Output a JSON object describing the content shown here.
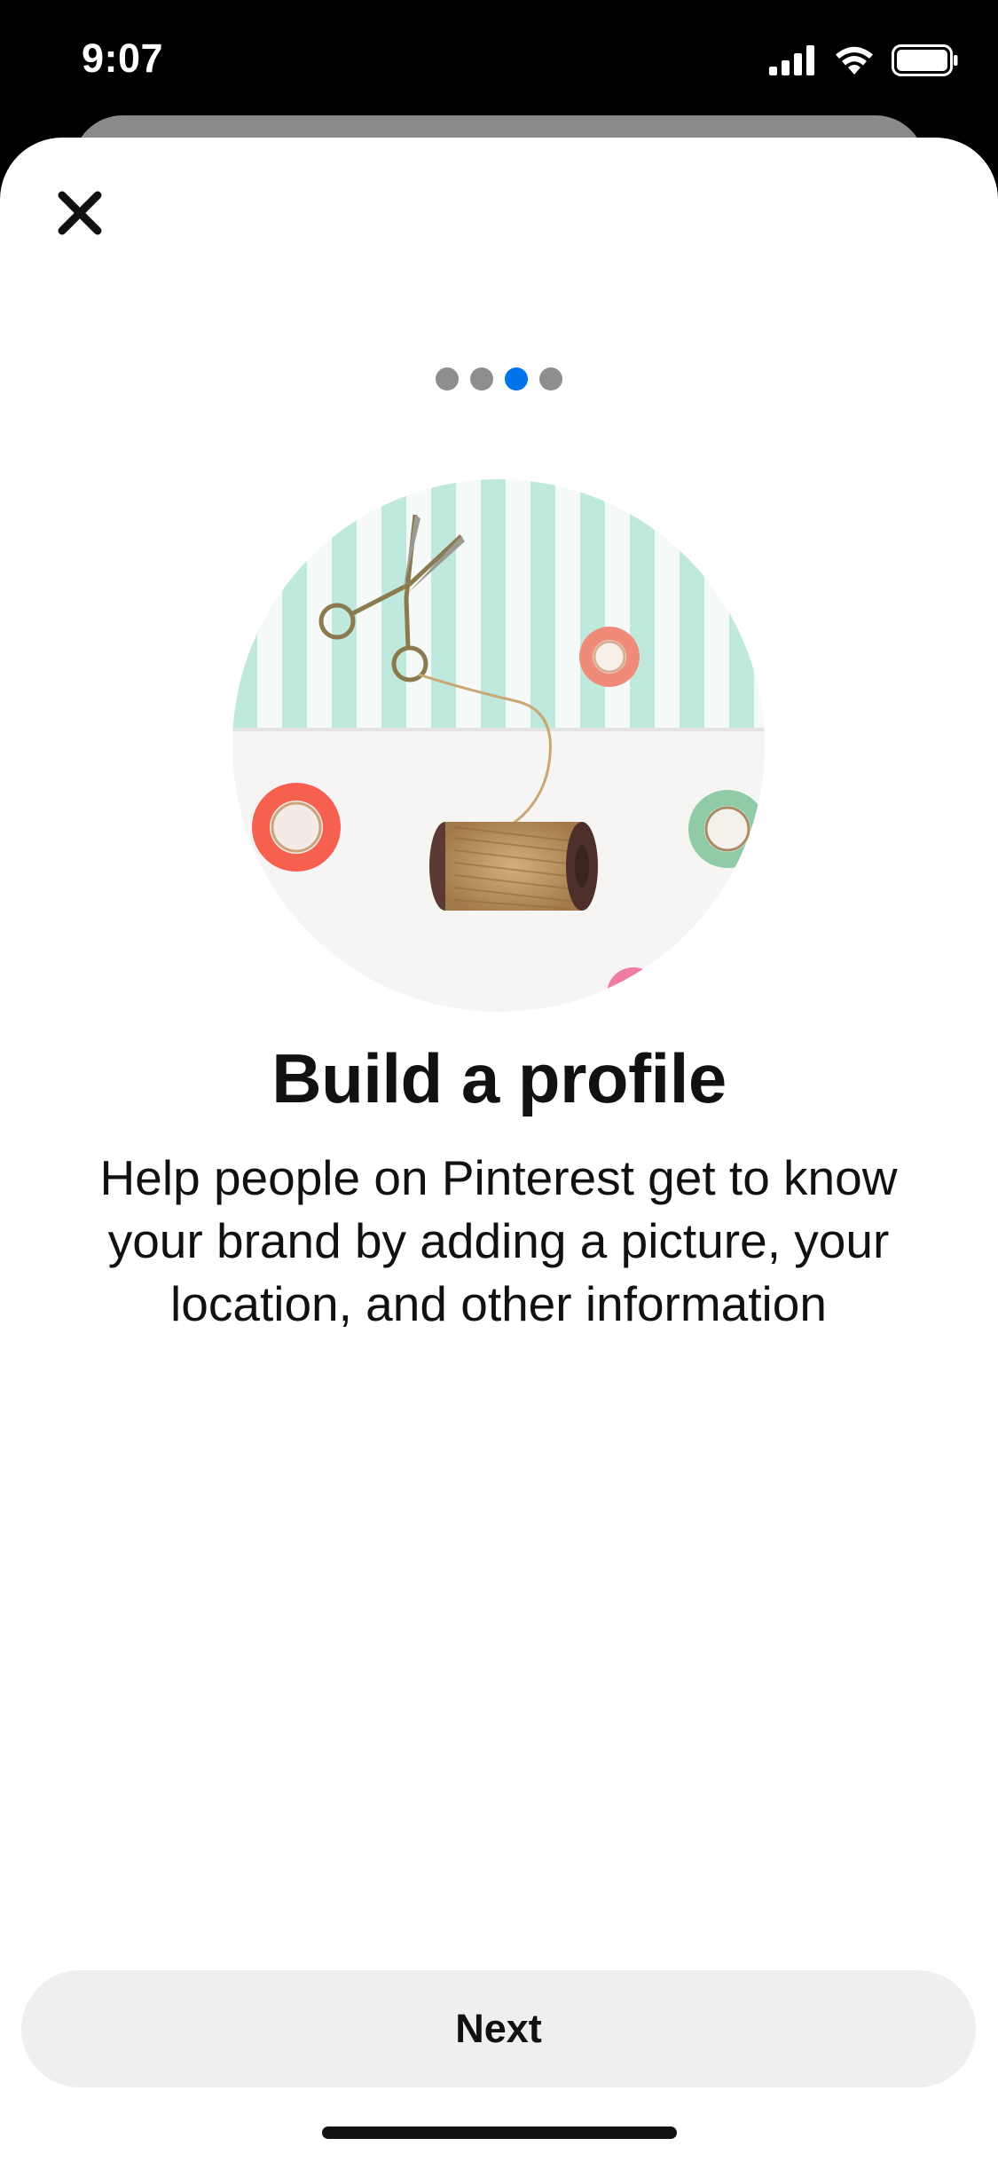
{
  "status_bar": {
    "time": "9:07",
    "icons": [
      "cellular-signal-icon",
      "wifi-icon",
      "battery-icon"
    ]
  },
  "toolbar": {
    "close_icon": "close-icon"
  },
  "pager": {
    "total": 4,
    "active_index": 2,
    "colors": {
      "active": "#0074e8",
      "inactive": "#8e8e8e"
    }
  },
  "hero_image": {
    "description_icon": "craft-supplies-illustration"
  },
  "content": {
    "title": "Build a profile",
    "body": "Help people on Pinterest get to know your brand by adding a picture, your location, and other information"
  },
  "actions": {
    "next_label": "Next"
  },
  "colors": {
    "button_bg": "#efefef",
    "text": "#111111",
    "accent": "#0074e8"
  }
}
